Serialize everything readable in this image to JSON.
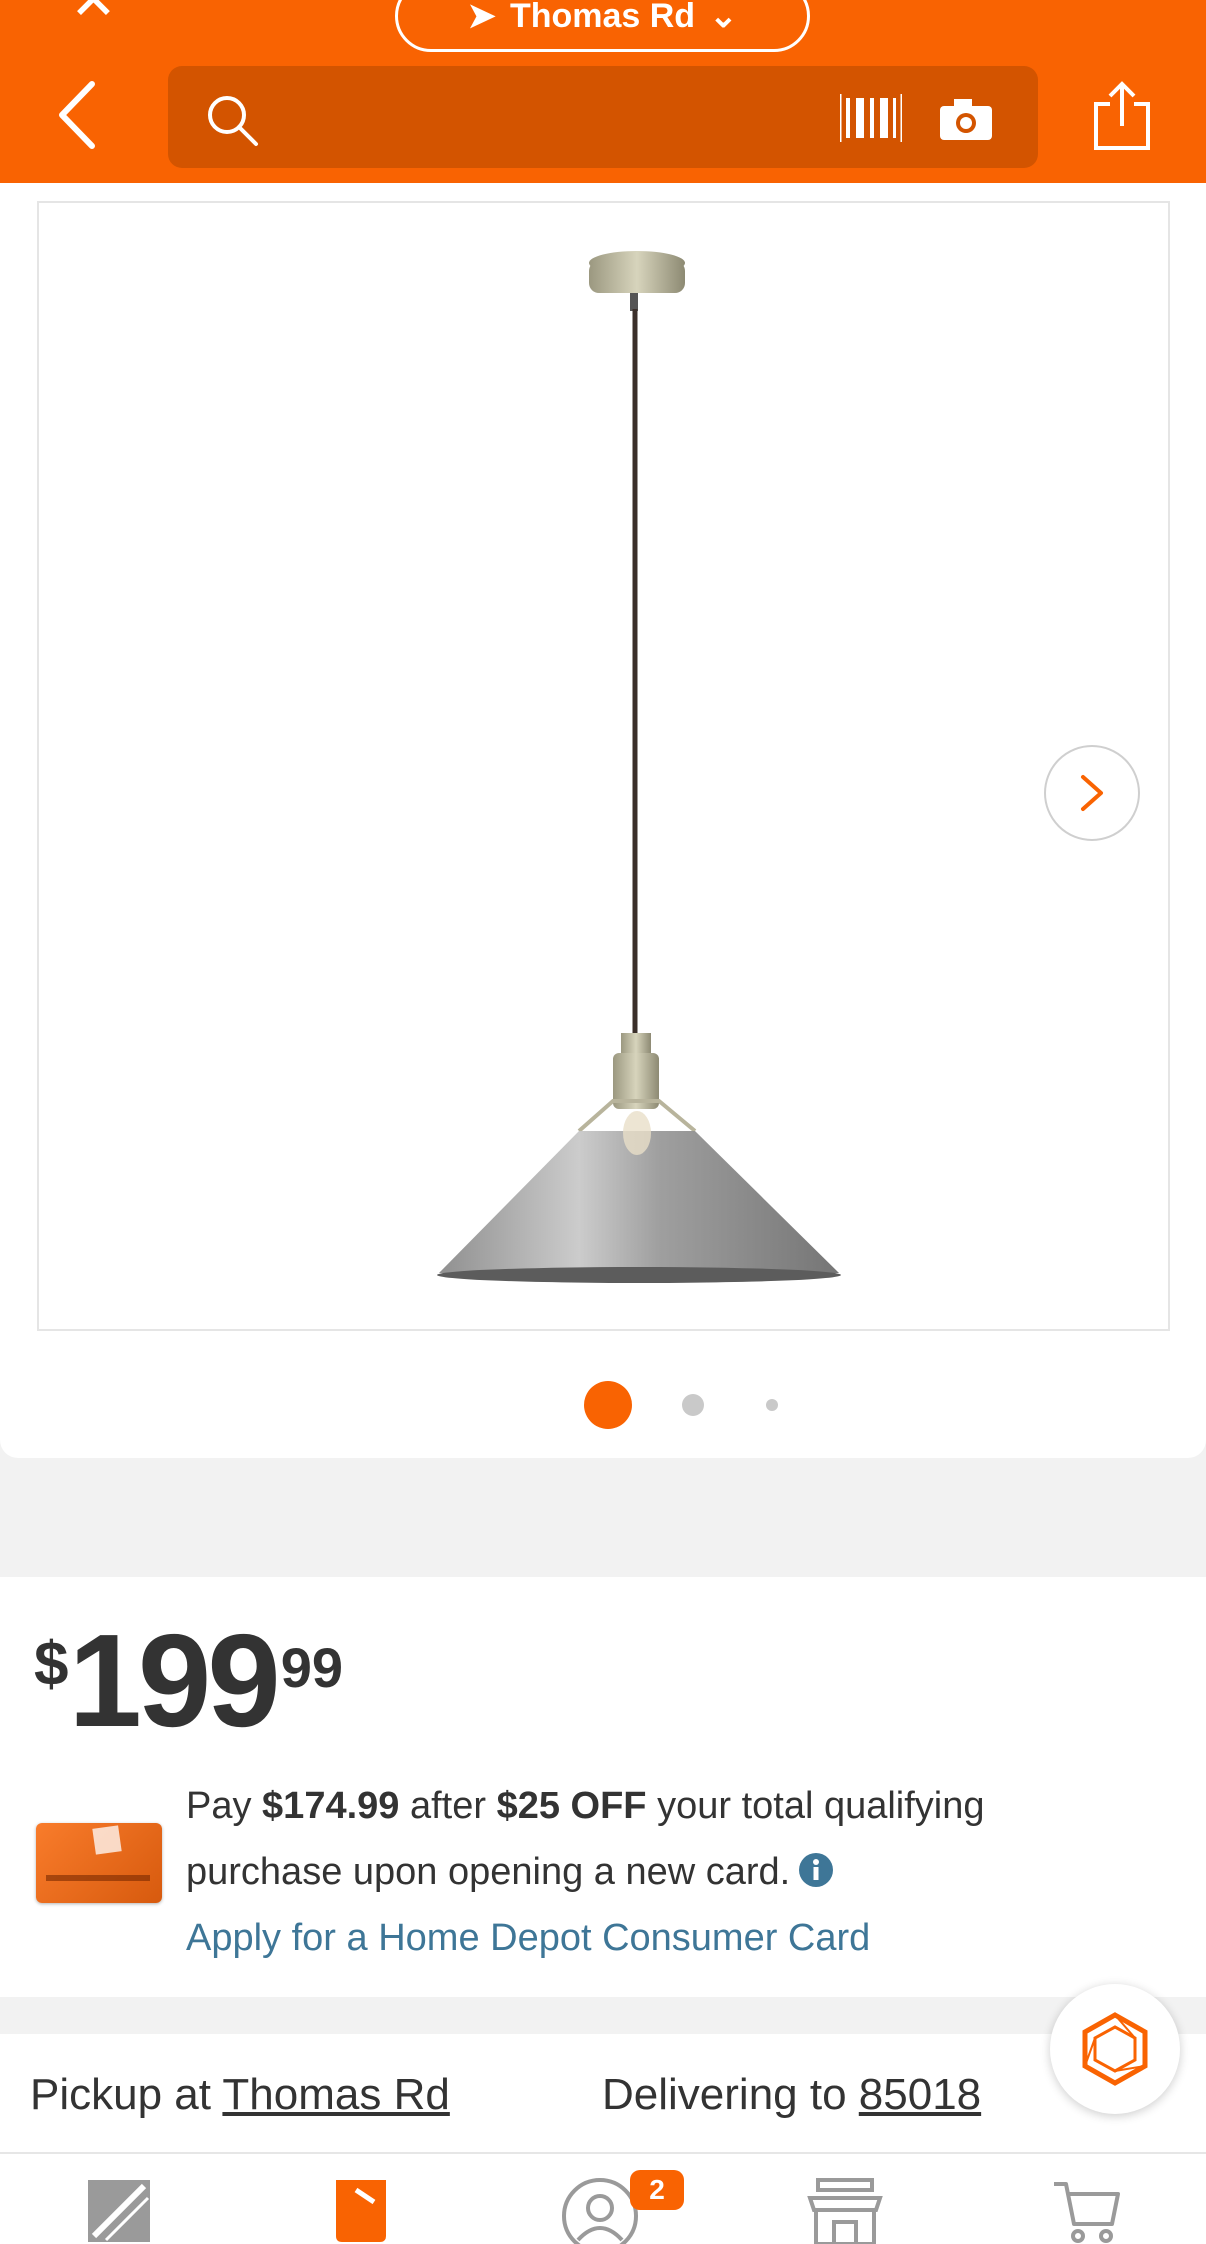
{
  "header": {
    "store_selector": "Thomas Rd",
    "search_placeholder": "",
    "colors": {
      "brand": "#f96302",
      "search_bg": "#d35400"
    }
  },
  "product": {
    "image_count": 3,
    "active_image": 1
  },
  "price": {
    "dollar_sign": "$",
    "whole": "199",
    "cents": "99"
  },
  "promo": {
    "pay_prefix": "Pay ",
    "pay_amount": "$174.99",
    "after_text": " after ",
    "discount": "$25 OFF",
    "rest": " your total qualifying purchase upon opening a new card.",
    "apply_link": "Apply for a Home Depot Consumer Card"
  },
  "fulfillment": {
    "pickup_label": "Pickup at ",
    "pickup_store": "Thomas Rd",
    "delivery_label": "Delivering to ",
    "delivery_zip": "85018"
  },
  "bottom_nav": {
    "account_badge": "2",
    "icons": [
      "home-depot-logo-icon",
      "shop-icon",
      "account-icon",
      "store-icon",
      "cart-icon"
    ]
  }
}
